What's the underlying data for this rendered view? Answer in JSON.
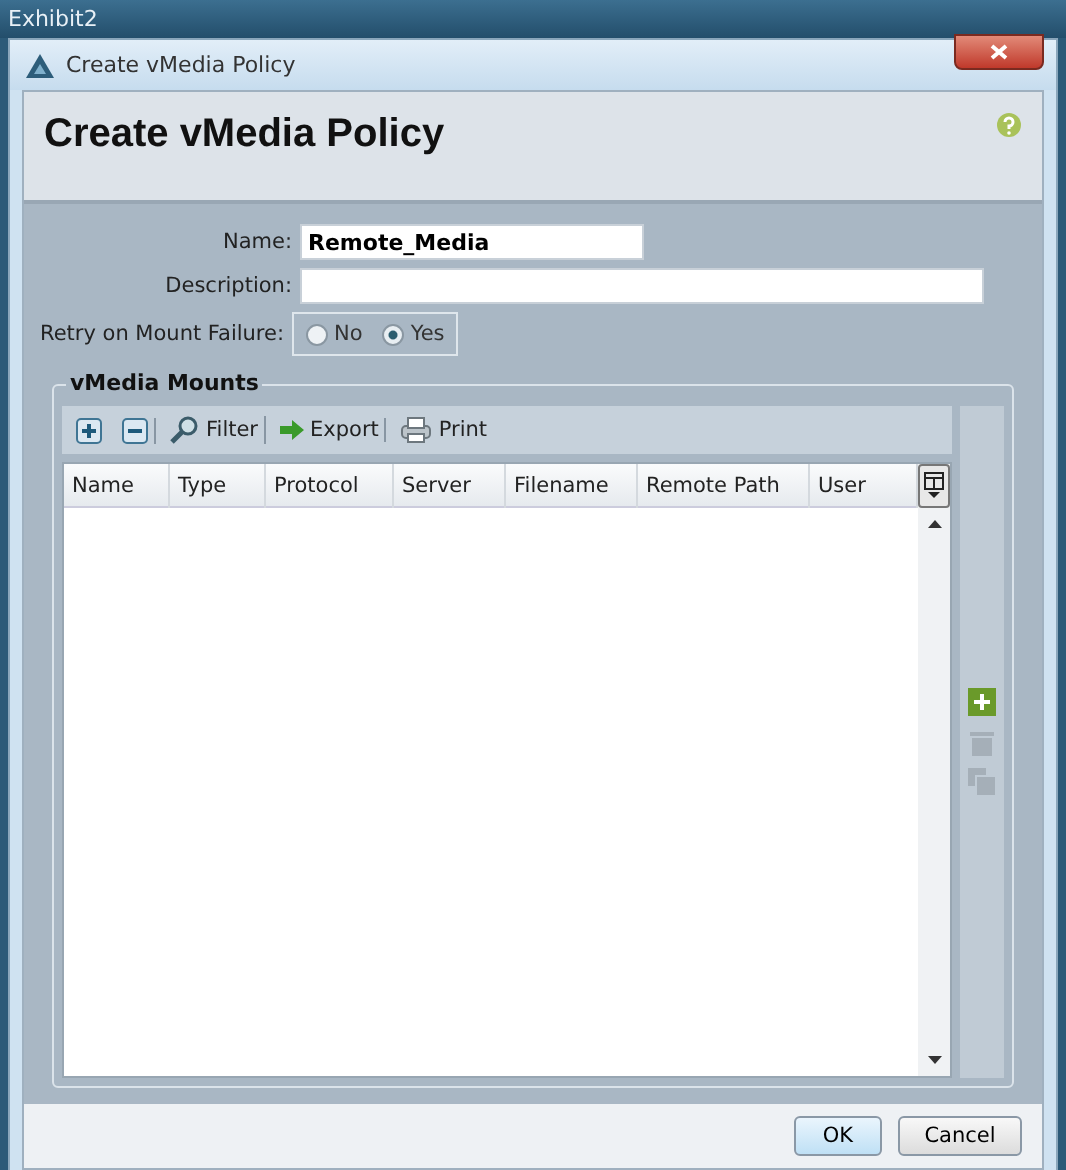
{
  "frame": {
    "title": "Exhibit2"
  },
  "window": {
    "title": "Create vMedia Policy"
  },
  "header": {
    "title": "Create vMedia Policy"
  },
  "form": {
    "name": {
      "label": "Name:",
      "value": "Remote_Media"
    },
    "description": {
      "label": "Description:"
    },
    "retry": {
      "label": "Retry on Mount Failure:",
      "options": [
        {
          "label": "No",
          "selected": false
        },
        {
          "label": "Yes",
          "selected": true
        }
      ]
    }
  },
  "mounts": {
    "title": "vMedia Mounts",
    "toolbar": [
      {
        "kind": "add"
      },
      {
        "kind": "remove"
      },
      {
        "kind": "filter",
        "label": "Filter"
      },
      {
        "kind": "export",
        "label": "Export"
      },
      {
        "kind": "print",
        "label": "Print"
      }
    ],
    "columns": [
      "Name",
      "Type",
      "Protocol",
      "Server",
      "Filename",
      "Remote Path",
      "User"
    ],
    "side": [
      {
        "kind": "add",
        "disabled": false
      },
      {
        "kind": "delete",
        "disabled": true
      },
      {
        "kind": "copy",
        "disabled": true
      }
    ]
  },
  "buttons": [
    "OK",
    "Cancel"
  ]
}
